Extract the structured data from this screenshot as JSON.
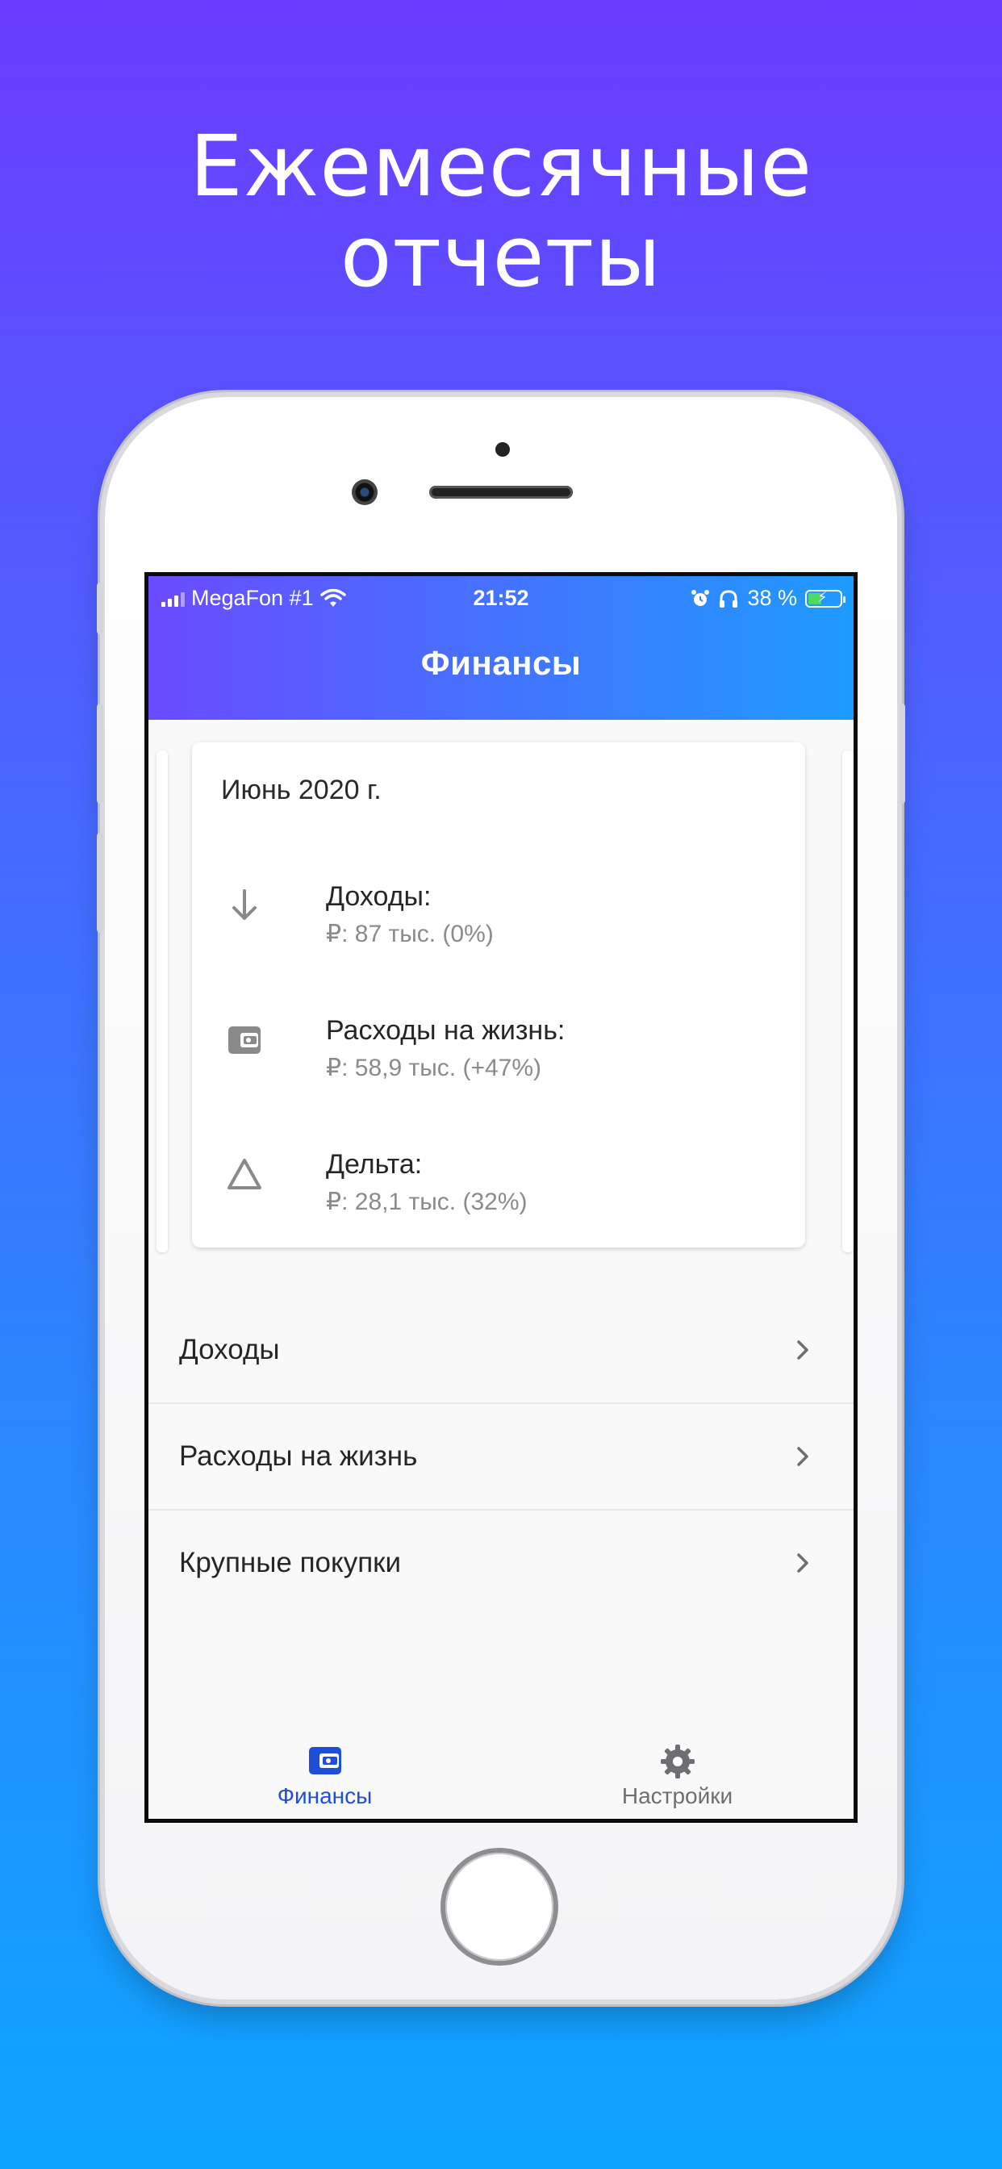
{
  "headline": {
    "line1": "Ежемесячные",
    "line2": "отчеты"
  },
  "status_bar": {
    "carrier": "MegaFon #1",
    "time": "21:52",
    "battery": "38 %"
  },
  "app_bar": {
    "title": "Финансы"
  },
  "summary": {
    "month": "Июнь 2020 г.",
    "items": [
      {
        "icon": "arrow-down-icon",
        "label": "Доходы:",
        "value": "₽: 87 тыс. (0%)"
      },
      {
        "icon": "wallet-icon",
        "label": "Расходы на жизнь:",
        "value": "₽: 58,9 тыс. (+47%)"
      },
      {
        "icon": "triangle-icon",
        "label": "Дельта:",
        "value": "₽: 28,1 тыс. (32%)"
      }
    ]
  },
  "menu": [
    {
      "label": "Доходы"
    },
    {
      "label": "Расходы на жизнь"
    },
    {
      "label": "Крупные покупки"
    }
  ],
  "bottom_nav": [
    {
      "label": "Финансы",
      "icon": "wallet-icon",
      "active": true
    },
    {
      "label": "Настройки",
      "icon": "gear-icon",
      "active": false
    }
  ],
  "colors": {
    "gradient_top": "#6b3cff",
    "gradient_bottom": "#0ea5ff",
    "active_tab": "#1f4fd9",
    "inactive_tab": "#6e6e73",
    "icon_grey": "#8a8a8a"
  }
}
